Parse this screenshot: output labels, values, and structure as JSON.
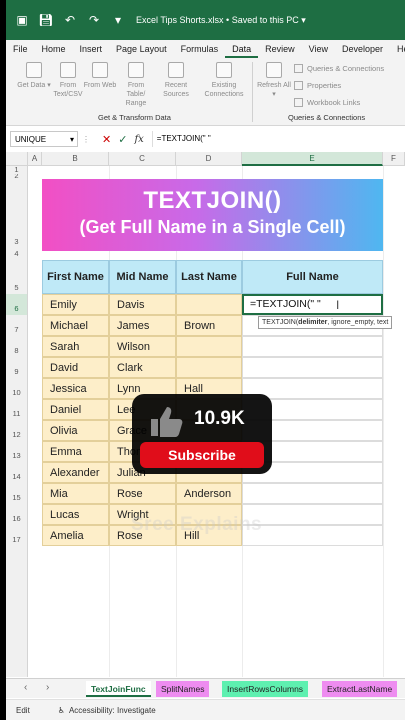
{
  "titlebar": {
    "filename": "Excel Tips Shorts.xlsx",
    "separator": "•",
    "save_status": "Saved to this PC"
  },
  "tabs": [
    "File",
    "Home",
    "Insert",
    "Page Layout",
    "Formulas",
    "Data",
    "Review",
    "View",
    "Developer",
    "He"
  ],
  "active_tab": "Data",
  "ribbon": {
    "get_data": "Get Data",
    "from_text": "From Text/CSV",
    "from_web": "From Web",
    "from_table": "From Table/ Range",
    "recent_sources": "Recent Sources",
    "existing_connections": "Existing Connections",
    "refresh_all": "Refresh All",
    "queries_connections": "Queries & Connections",
    "properties": "Properties",
    "workbook_links": "Workbook Links",
    "group_get_transform": "Get & Transform Data",
    "group_queries": "Queries & Connections"
  },
  "formula_bar": {
    "name_box": "UNIQUE",
    "cancel": "✕",
    "enter": "✓",
    "fx": "fx",
    "content": "=TEXTJOIN(\" \""
  },
  "columns": [
    "A",
    "B",
    "C",
    "D",
    "E",
    "F"
  ],
  "rows": [
    "1",
    "2",
    "3",
    "4",
    "5",
    "6",
    "7",
    "8",
    "9",
    "10",
    "11",
    "12",
    "13",
    "14",
    "15",
    "16",
    "17"
  ],
  "banner": {
    "title": "TEXTJOIN()",
    "subtitle": "(Get Full Name in a Single Cell)"
  },
  "table": {
    "headers": [
      "First Name",
      "Mid Name",
      "Last Name",
      "Full Name"
    ],
    "rows": [
      [
        "Emily",
        "Davis",
        ""
      ],
      [
        "Michael",
        "James",
        "Brown"
      ],
      [
        "Sarah",
        "Wilson",
        ""
      ],
      [
        "David",
        "Clark",
        ""
      ],
      [
        "Jessica",
        "Lynn",
        "Hall"
      ],
      [
        "Daniel",
        "Lee",
        ""
      ],
      [
        "Olivia",
        "Grace",
        ""
      ],
      [
        "Emma",
        "Thomas",
        ""
      ],
      [
        "Alexander",
        "Julian",
        ""
      ],
      [
        "Mia",
        "Rose",
        "Anderson"
      ],
      [
        "Lucas",
        "Wright",
        ""
      ],
      [
        "Amelia",
        "Rose",
        "Hill"
      ]
    ]
  },
  "active_cell": {
    "content": "=TEXTJOIN(\" \""
  },
  "tooltip": {
    "func": "TEXTJOIN(",
    "arg_bold": "delimiter",
    "rest": ", ignore_empty, text"
  },
  "watermark": "Sree Explains",
  "subscribe": {
    "count": "10.9K",
    "button": "Subscribe"
  },
  "sheets": [
    {
      "name": "TextJoinFunc",
      "style": "active"
    },
    {
      "name": "SplitNames",
      "style": "pink"
    },
    {
      "name": "InsertRowsColumns",
      "style": "green"
    },
    {
      "name": "ExtractLastName",
      "style": "pink"
    }
  ],
  "status": {
    "mode": "Edit",
    "accessibility": "Accessibility: Investigate"
  }
}
